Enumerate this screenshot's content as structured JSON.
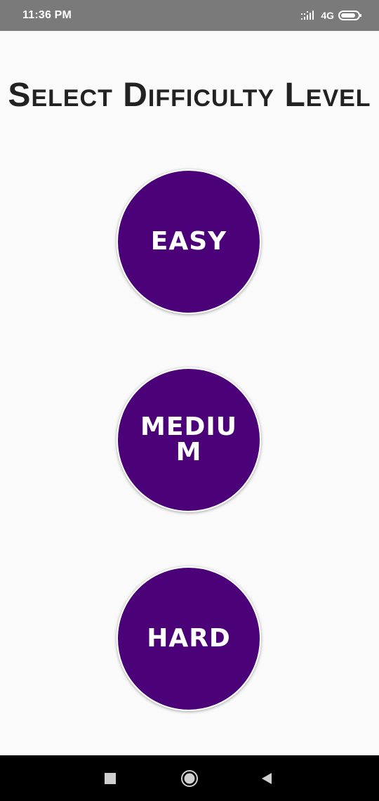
{
  "status_bar": {
    "time": "11:36 PM",
    "network": "4G",
    "icons": [
      "signal-icon",
      "battery-icon"
    ],
    "background": "#7a7a7a"
  },
  "screen": {
    "title": "Select Difficulty Level",
    "background": "#fafafa"
  },
  "levels": [
    {
      "label": "EASY"
    },
    {
      "label": "MEDIUM"
    },
    {
      "label": "HARD"
    }
  ],
  "button_color": "#4b0178",
  "nav_bar": {
    "icons": [
      "recents-icon",
      "home-icon",
      "back-icon"
    ],
    "background": "#000000"
  }
}
